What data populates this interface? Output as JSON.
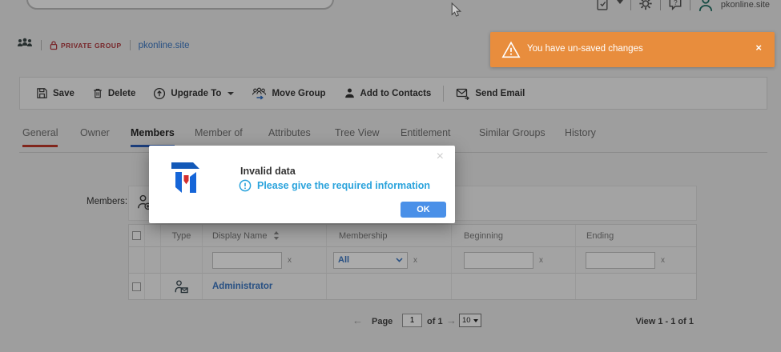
{
  "colors": {
    "toast-bg": "#e88d3d",
    "ok-bg": "#4a90e8",
    "info": "#2aa3dc",
    "link": "#3c78c3",
    "badge-red": "#b23a3f",
    "tab-active": "#2b5db8",
    "tab-invalid": "#c0392b"
  },
  "header": {
    "account": "pkonline.site"
  },
  "breadcrumb": {
    "badge": "PRIVATE GROUP",
    "group": "pkonline.site"
  },
  "toast": {
    "message": "You have un-saved changes",
    "close": "×"
  },
  "toolbar": {
    "save": "Save",
    "delete": "Delete",
    "upgrade": "Upgrade To",
    "move": "Move Group",
    "contacts": "Add to Contacts",
    "email": "Send Email"
  },
  "tabs": {
    "items": [
      {
        "label": "General",
        "state": "invalid"
      },
      {
        "label": "Owner",
        "state": ""
      },
      {
        "label": "Members",
        "state": "active"
      },
      {
        "label": "Member of",
        "state": ""
      },
      {
        "label": "Attributes",
        "state": ""
      },
      {
        "label": "Tree View",
        "state": ""
      },
      {
        "label": "Entitlement",
        "state": ""
      },
      {
        "label": "Similar Groups",
        "state": ""
      },
      {
        "label": "History",
        "state": ""
      }
    ]
  },
  "modal": {
    "title": "Invalid data",
    "message": "Please give the required information",
    "ok": "OK",
    "close": "×"
  },
  "members": {
    "label": "Members:",
    "table": {
      "columns": {
        "type": "Type",
        "display_name": "Display Name",
        "membership": "Membership",
        "beginning": "Beginning",
        "ending": "Ending"
      },
      "filters": {
        "display_name": "",
        "membership": "All",
        "beginning": "",
        "ending": "",
        "clear": "x"
      },
      "rows": [
        {
          "display_name": "Administrator"
        }
      ]
    }
  },
  "pagination": {
    "prev": "←",
    "page_label": "Page",
    "page": "1",
    "of": "of 1",
    "next": "→",
    "size": "10",
    "view": "View 1 - 1 of 1"
  }
}
